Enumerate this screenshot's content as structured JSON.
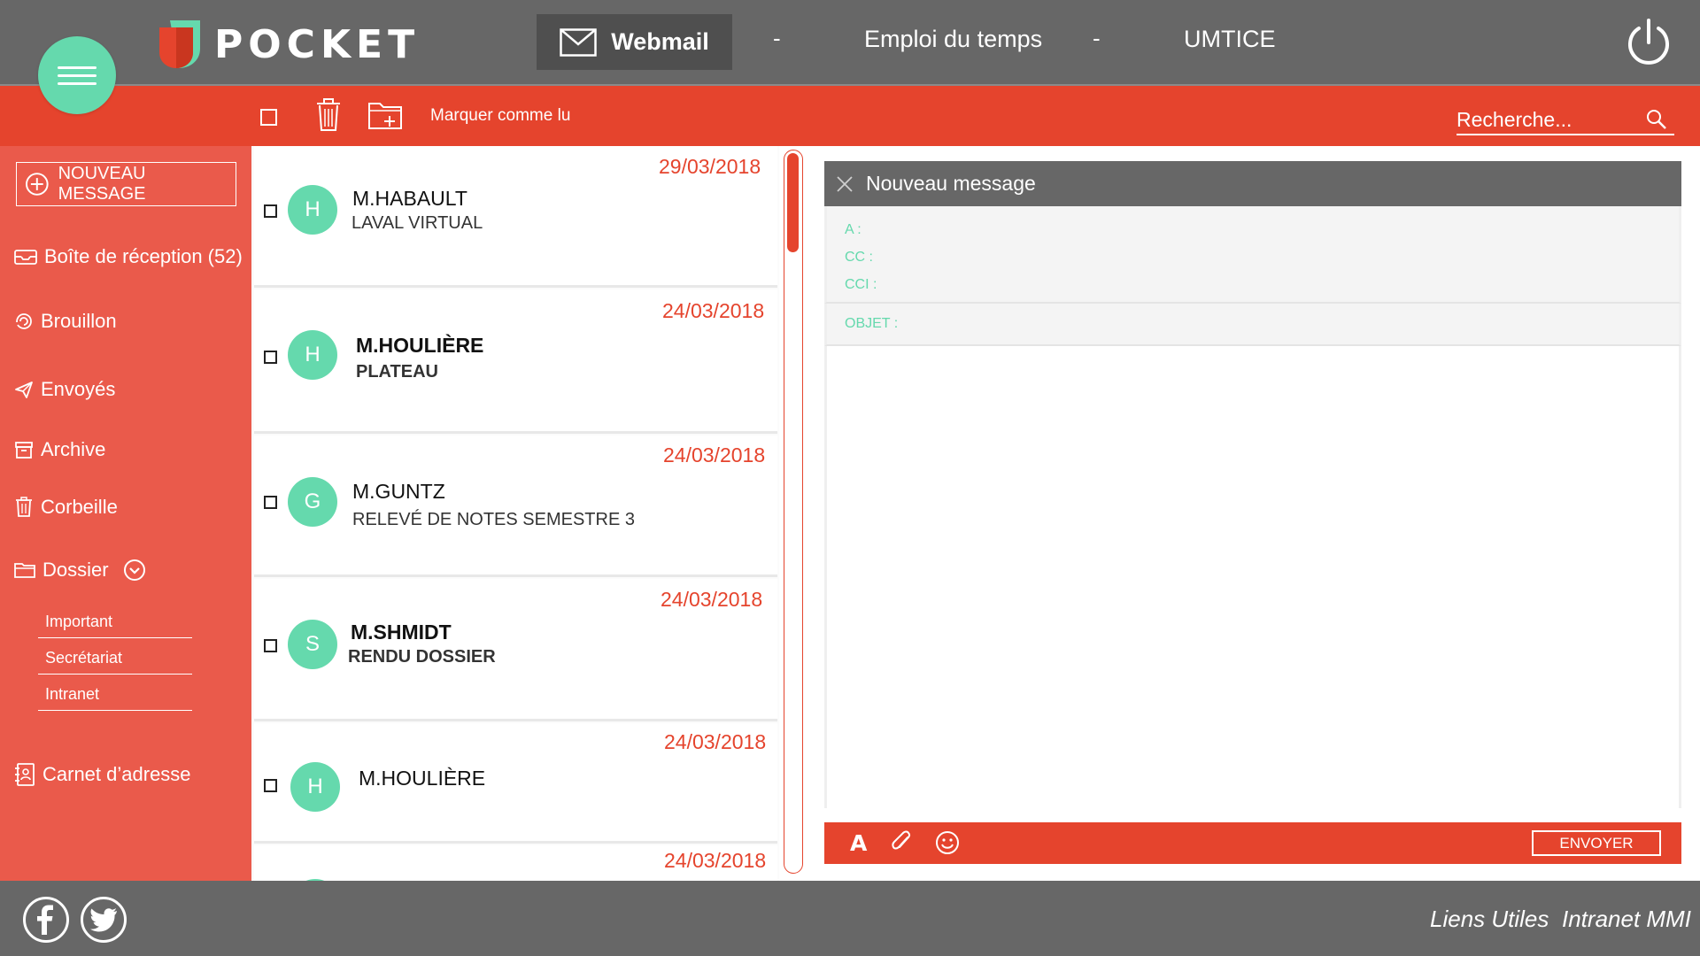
{
  "app": {
    "logo_text": "POCKET"
  },
  "nav": {
    "webmail": "Webmail",
    "separator": "-",
    "schedule": "Emploi du temps",
    "umtice": "UMTICE"
  },
  "toolbar": {
    "mark_read": "Marquer comme lu",
    "search_placeholder": "Recherche..."
  },
  "sidebar": {
    "new_message": "NOUVEAU MESSAGE",
    "items": [
      {
        "label": "Boîte de réception (52)",
        "icon": "inbox-icon"
      },
      {
        "label": "Brouillon",
        "icon": "draft-icon"
      },
      {
        "label": "Envoyés",
        "icon": "send-icon"
      },
      {
        "label": "Archive",
        "icon": "archive-icon"
      },
      {
        "label": "Corbeille",
        "icon": "trash-icon"
      },
      {
        "label": "Dossier",
        "icon": "folder-icon"
      }
    ],
    "subfolders": [
      "Important",
      "Secrétariat",
      "Intranet"
    ],
    "address_book": "Carnet d’adresse"
  },
  "mails": [
    {
      "initial": "H",
      "sender": "M.HABAULT",
      "subject": "LAVAL VIRTUAL",
      "date": "29/03/2018",
      "unread": false
    },
    {
      "initial": "H",
      "sender": "M.HOULIÈRE",
      "subject": "PLATEAU",
      "date": "24/03/2018",
      "unread": true
    },
    {
      "initial": "G",
      "sender": "M.GUNTZ",
      "subject": "RELEVÉ DE NOTES SEMESTRE 3",
      "date": "24/03/2018",
      "unread": false
    },
    {
      "initial": "S",
      "sender": "M.SHMIDT",
      "subject": "RENDU DOSSIER",
      "date": "24/03/2018",
      "unread": true
    },
    {
      "initial": "H",
      "sender": "M.HOULIÈRE",
      "subject": "",
      "date": "24/03/2018",
      "unread": false
    },
    {
      "initial": "",
      "sender": "",
      "subject": "",
      "date": "24/03/2018",
      "unread": false
    }
  ],
  "compose": {
    "title": "Nouveau message",
    "to_label": "A :",
    "cc_label": "CC :",
    "bcc_label": "CCI :",
    "subject_label": "OBJET :",
    "to_value": "",
    "cc_value": "",
    "bcc_value": "",
    "subject_value": "",
    "body_value": "",
    "font_button": "A",
    "send": "ENVOYER"
  },
  "footer": {
    "useful_links": "Liens Utiles",
    "intranet": "Intranet MMI"
  },
  "colors": {
    "accent_red": "#e5442d",
    "sidebar_red": "#ea5a4b",
    "mint": "#65d9ad",
    "dark_gray": "#676767"
  }
}
